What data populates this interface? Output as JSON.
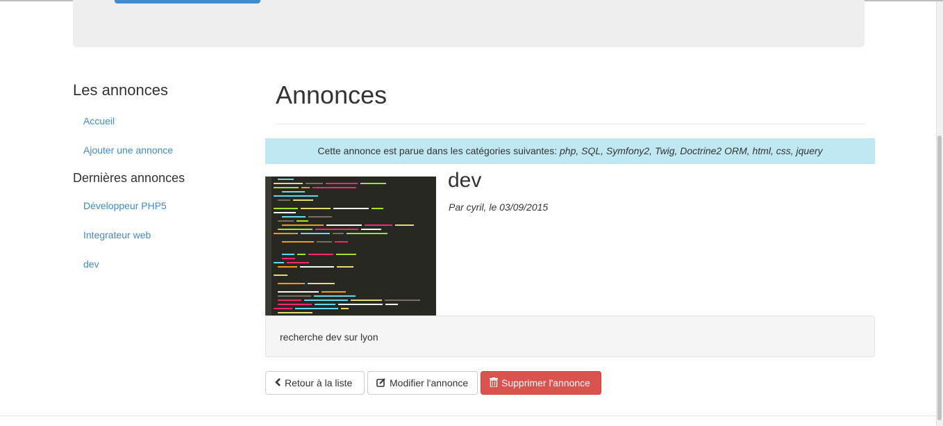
{
  "sidebar": {
    "title": "Les annonces",
    "links": [
      "Accueil",
      "Ajouter une annonce"
    ],
    "subtitle": "Dernières annonces",
    "recent": [
      "Développeur PHP5",
      "Integrateur web",
      "dev"
    ]
  },
  "main": {
    "title": "Annonces",
    "categories_prefix": "Cette annonce est parue dans les catégories suivantes: ",
    "categories": "php, SQL, Symfony2, Twig, Doctrine2 ORM, html, css, jquery",
    "advert": {
      "title": "dev",
      "meta": "Par cyril, le 03/09/2015",
      "content": "recherche dev sur lyon",
      "image_icon": "code-screenshot-image"
    },
    "buttons": {
      "back": "Retour à la liste",
      "edit": "Modifier l'annonce",
      "delete": "Supprimer l'annonce"
    }
  },
  "colors": {
    "link": "#428bca",
    "info_bg": "#bfe8f2",
    "danger": "#d9534f",
    "jumbotron": "#eeeeee"
  }
}
